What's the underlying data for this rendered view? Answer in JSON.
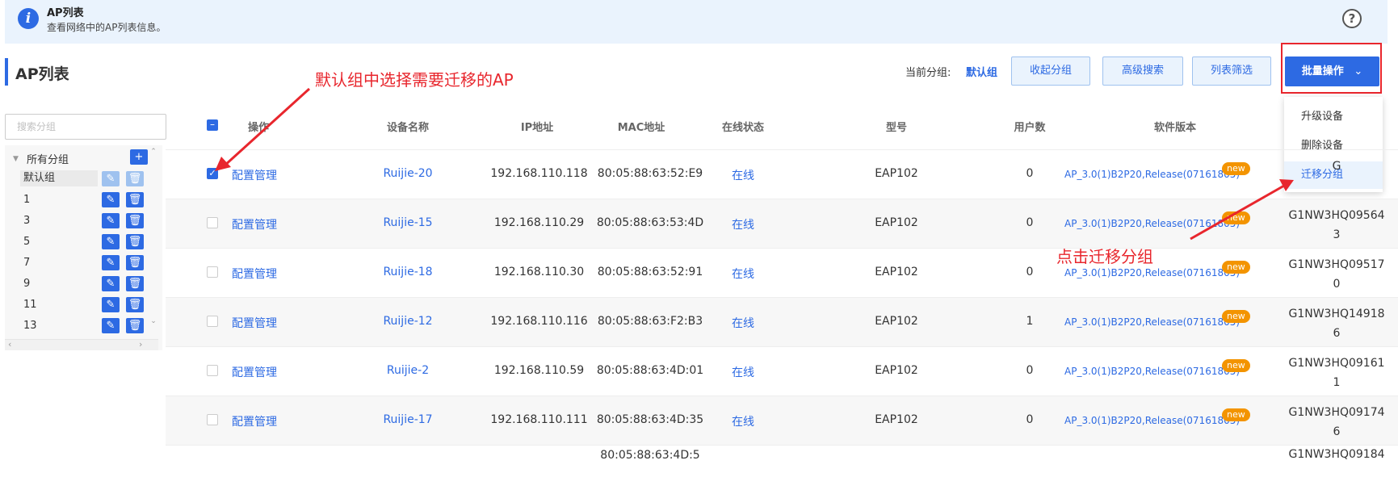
{
  "banner": {
    "icon": "info-icon",
    "title": "AP列表",
    "description": "查看网络中的AP列表信息。",
    "help_icon": "question-circle-icon"
  },
  "header": {
    "title": "AP列表",
    "current_group_label": "当前分组:",
    "current_group_value": "默认组",
    "collapse_label": "收起分组",
    "advanced_search_label": "高级搜索",
    "list_filter_label": "列表筛选",
    "batch_label": "批量操作",
    "batch_icon": "chevron-down-icon"
  },
  "dropdown": {
    "items": [
      "升级设备",
      "删除设备",
      "迁移分组"
    ],
    "selected_index": 2
  },
  "sidebar": {
    "search_placeholder": "搜索分组",
    "root_label": "所有分组",
    "groups": [
      "默认组",
      "1",
      "3",
      "5",
      "7",
      "9",
      "11",
      "13"
    ]
  },
  "table": {
    "columns": [
      "操作",
      "设备名称",
      "IP地址",
      "MAC地址",
      "在线状态",
      "型号",
      "用户数",
      "软件版本"
    ],
    "new_badge": "new",
    "action_label": "配置管理",
    "rows": [
      {
        "checked": true,
        "name": "Ruijie-20",
        "ip": "192.168.110.118",
        "mac": "80:05:88:63:52:E9",
        "status": "在线",
        "model": "EAP102",
        "users": "0",
        "version": "AP_3.0(1)B2P20,Release(07161805)",
        "sn_l1": "G",
        "sn_l2": ""
      },
      {
        "checked": false,
        "name": "Ruijie-15",
        "ip": "192.168.110.29",
        "mac": "80:05:88:63:53:4D",
        "status": "在线",
        "model": "EAP102",
        "users": "0",
        "version": "AP_3.0(1)B2P20,Release(07161805)",
        "sn_l1": "G1NW3HQ09564",
        "sn_l2": "3"
      },
      {
        "checked": false,
        "name": "Ruijie-18",
        "ip": "192.168.110.30",
        "mac": "80:05:88:63:52:91",
        "status": "在线",
        "model": "EAP102",
        "users": "0",
        "version": "AP_3.0(1)B2P20,Release(07161805)",
        "sn_l1": "G1NW3HQ09517",
        "sn_l2": "0"
      },
      {
        "checked": false,
        "name": "Ruijie-12",
        "ip": "192.168.110.116",
        "mac": "80:05:88:63:F2:B3",
        "status": "在线",
        "model": "EAP102",
        "users": "1",
        "version": "AP_3.0(1)B2P20,Release(07161805)",
        "sn_l1": "G1NW3HQ14918",
        "sn_l2": "6"
      },
      {
        "checked": false,
        "name": "Ruijie-2",
        "ip": "192.168.110.59",
        "mac": "80:05:88:63:4D:01",
        "status": "在线",
        "model": "EAP102",
        "users": "0",
        "version": "AP_3.0(1)B2P20,Release(07161805)",
        "sn_l1": "G1NW3HQ09161",
        "sn_l2": "1"
      },
      {
        "checked": false,
        "name": "Ruijie-17",
        "ip": "192.168.110.111",
        "mac": "80:05:88:63:4D:35",
        "status": "在线",
        "model": "EAP102",
        "users": "0",
        "version": "AP_3.0(1)B2P20,Release(07161805)",
        "sn_l1": "G1NW3HQ09174",
        "sn_l2": "6"
      },
      {
        "checked": false,
        "name": "",
        "ip": "",
        "mac": "80:05:88:63:4D:5",
        "status": "",
        "model": "",
        "users": "",
        "version": "",
        "sn_l1": "G1NW3HQ09184",
        "sn_l2": ""
      }
    ]
  },
  "annotations": {
    "select_ap": "默认组中选择需要迁移的AP",
    "click_migrate": "点击迁移分组"
  },
  "colors": {
    "accent": "#2d6ae3",
    "annotation": "#e8262d",
    "badge": "#f39400"
  }
}
